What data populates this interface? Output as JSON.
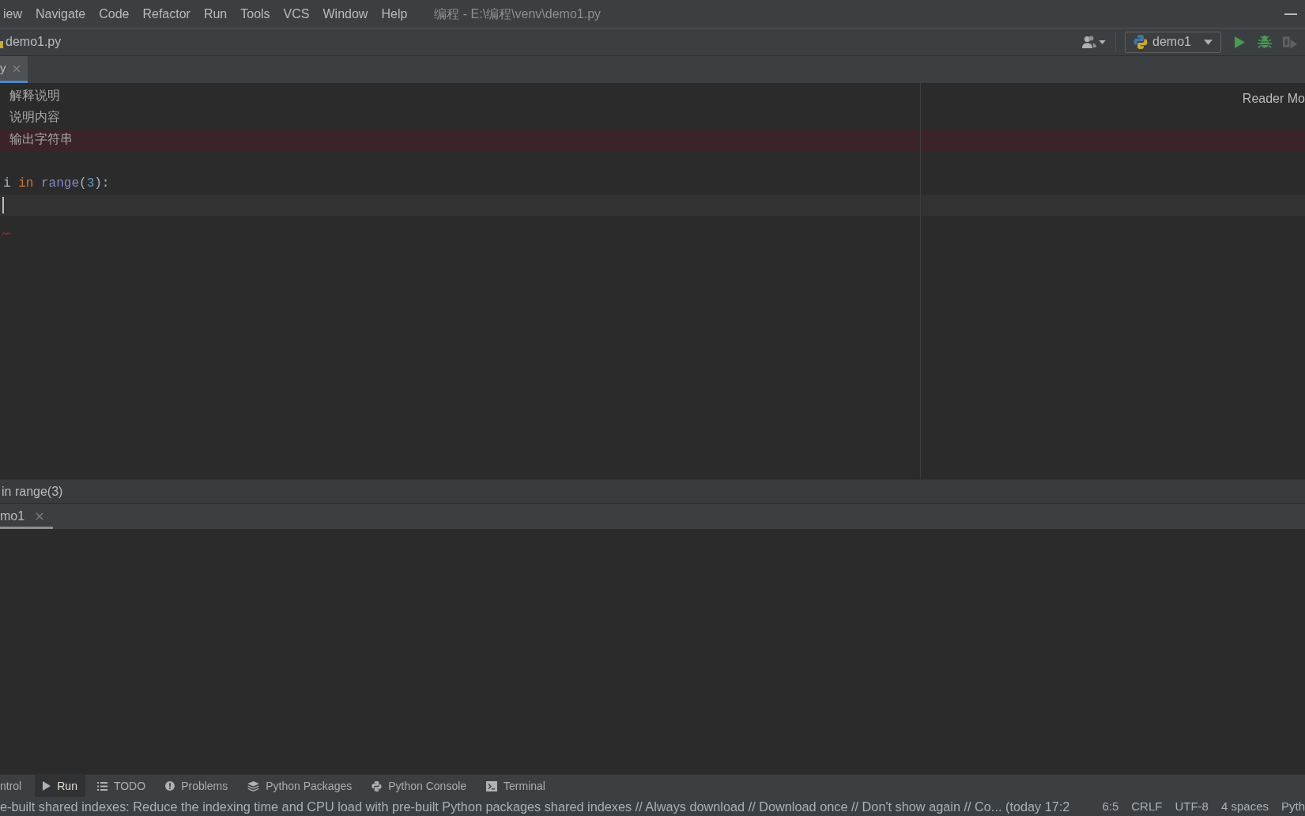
{
  "menu_bar": {
    "items": [
      "iew",
      "Navigate",
      "Code",
      "Refactor",
      "Run",
      "Tools",
      "VCS",
      "Window",
      "Help"
    ],
    "title": "编程 - E:\\编程\\venv\\demo1.py"
  },
  "navigation_bar": {
    "file": "demo1.py",
    "run_configuration": "demo1"
  },
  "editor_tabs": [
    {
      "label": "y",
      "selected": true
    }
  ],
  "editor": {
    "reader_mode": "Reader Mo",
    "lines": [
      {
        "tokens": [
          {
            "text": "解释说明",
            "kind": "comment"
          }
        ],
        "breakpoint": false,
        "caret": false,
        "error": false
      },
      {
        "tokens": [
          {
            "text": "说明内容",
            "kind": "comment"
          }
        ],
        "breakpoint": false,
        "caret": false,
        "error": false
      },
      {
        "tokens": [
          {
            "text": "输出字符串",
            "kind": "comment"
          }
        ],
        "breakpoint": true,
        "caret": false,
        "error": false
      },
      {
        "breakpoint": false,
        "caret": false,
        "error": false
      },
      {
        "tokens": [
          {
            "text": "i ",
            "kind": "plain"
          },
          {
            "text": "in",
            "kind": "keyword"
          },
          {
            "text": " range",
            "kind": "builtin"
          },
          {
            "text": "(",
            "kind": "plain"
          },
          {
            "text": "3",
            "kind": "number"
          },
          {
            "text": "):",
            "kind": "plain"
          }
        ],
        "breakpoint": false,
        "caret": false,
        "error": false
      },
      {
        "breakpoint": false,
        "caret": true,
        "error": false
      },
      {
        "breakpoint": false,
        "caret": false,
        "error": true
      }
    ]
  },
  "breadcrumb": "in range(3)",
  "run_panel": {
    "tabs": [
      {
        "label": "mo1",
        "selected": true
      }
    ]
  },
  "tool_windows": [
    {
      "label": "ntrol",
      "selected": false
    },
    {
      "label": "Run",
      "selected": true
    },
    {
      "label": "TODO",
      "selected": false
    },
    {
      "label": "Problems",
      "selected": false
    },
    {
      "label": "Python Packages",
      "selected": false
    },
    {
      "label": "Python Console",
      "selected": false
    },
    {
      "label": "Terminal",
      "selected": false
    }
  ],
  "status_bar": {
    "message": "e-built shared indexes: Reduce the indexing time and CPU load with pre-built Python packages shared indexes // Always download // Download once // Don't show again // Co... (today 17:2",
    "items": [
      "6:5",
      "CRLF",
      "UTF-8",
      "4 spaces",
      "Pyth"
    ]
  }
}
